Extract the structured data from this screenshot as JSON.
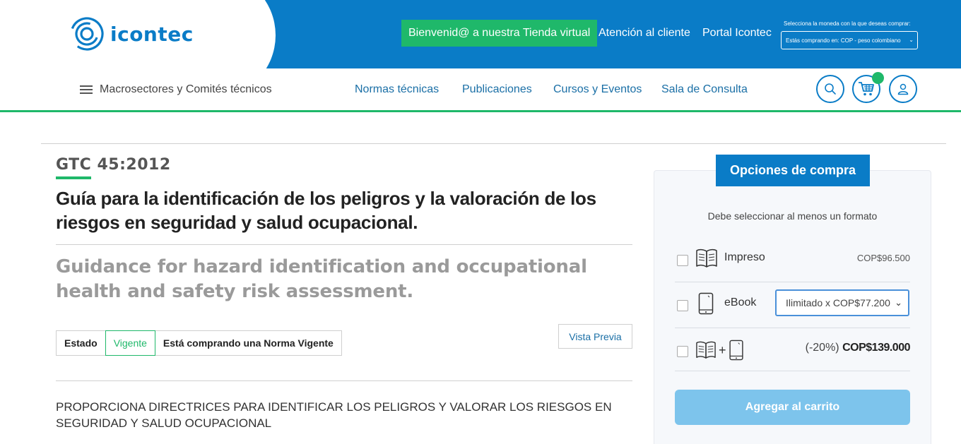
{
  "header": {
    "logo_text": "icontec",
    "welcome": "Bienvenid@ a nuestra Tienda virtual",
    "atencion": "Atención al cliente",
    "portal": "Portal Icontec",
    "currency_label": "Selecciona la moneda con la que deseas comprar:",
    "currency_value": "Estás comprando en: COP - peso colombiano"
  },
  "nav": {
    "macro": "Macrosectores y Comités técnicos",
    "links": [
      "Normas técnicas",
      "Publicaciones",
      "Cursos y Eventos",
      "Sala de Consulta"
    ]
  },
  "product": {
    "code": "GTC 45:2012",
    "title_es": "Guía para la identificación de los peligros y la valoración de los riesgos en seguridad y salud ocupacional.",
    "title_en": "Guidance for hazard identification and occupational health and safety risk assessment.",
    "status_label": "Estado",
    "status_value": "Vigente",
    "status_note": "Está comprando una Norma Vigente",
    "preview": "Vista Previa",
    "description": "PROPORCIONA DIRECTRICES PARA IDENTIFICAR LOS PELIGROS Y VALORAR LOS RIESGOS EN SEGURIDAD Y SALUD OCUPACIONAL"
  },
  "purchase": {
    "tab": "Opciones de compra",
    "note": "Debe seleccionar al menos un formato",
    "printed_label": "Impreso",
    "printed_price": "COP$96.500",
    "ebook_label": "eBook",
    "ebook_option": "Ilimitado x COP$77.200",
    "combo_plus": "+",
    "combo_discount": "(-20%)",
    "combo_price": "COP$139.000",
    "add_button": "Agregar al carrito"
  },
  "colors": {
    "brand_blue": "#0a7cc7",
    "brand_green": "#1fb86a",
    "button_light_blue": "#7dc4ec"
  },
  "icons": [
    "logo-icon",
    "hamburger-icon",
    "search-icon",
    "cart-icon",
    "user-icon",
    "book-icon",
    "tablet-icon",
    "chevron-down-icon"
  ]
}
